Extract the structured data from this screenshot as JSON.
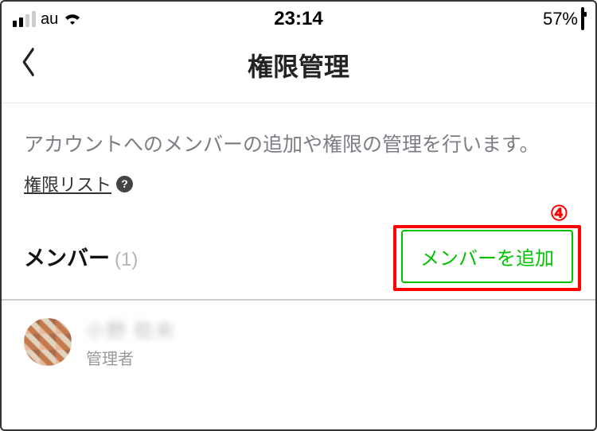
{
  "status": {
    "carrier": "au",
    "time": "23:14",
    "battery_pct": "57%"
  },
  "nav": {
    "title": "権限管理"
  },
  "body": {
    "description": "アカウントへのメンバーの追加や権限の管理を行います。",
    "perm_list_link": "権限リスト"
  },
  "members": {
    "heading": "メンバー",
    "count_open": "(",
    "count_value": "1",
    "count_close": ")",
    "add_button": "メンバーを追加",
    "annotation": "④"
  },
  "list": {
    "item0": {
      "name_obscured": "小野 稔央",
      "role": "管理者"
    }
  }
}
